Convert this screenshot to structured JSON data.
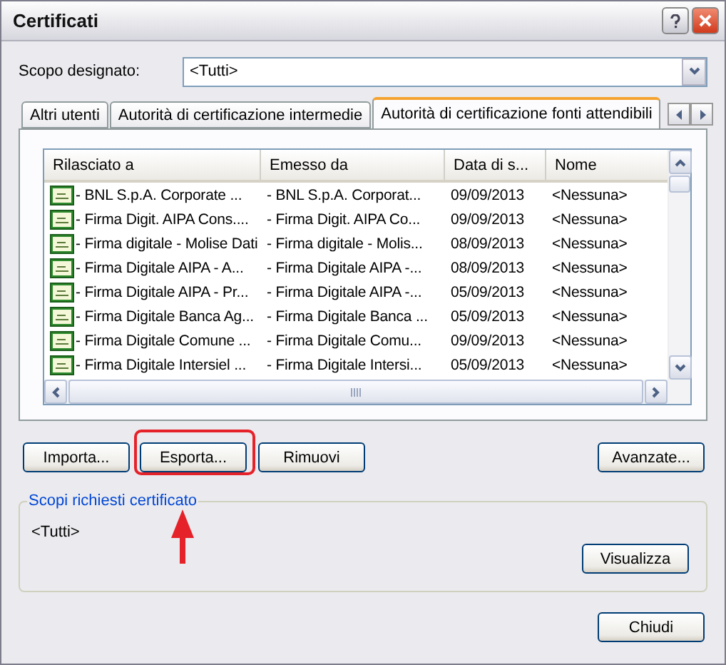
{
  "window": {
    "title": "Certificati"
  },
  "scope": {
    "label": "Scopo designato:",
    "value": "<Tutti>"
  },
  "tabs": [
    {
      "label": "Altri utenti",
      "selected": false
    },
    {
      "label": "Autorità di certificazione intermedie",
      "selected": false
    },
    {
      "label": "Autorità di certificazione fonti attendibili",
      "selected": true
    }
  ],
  "table": {
    "columns": [
      "Rilasciato a",
      "Emesso da",
      "Data di s...",
      "Nome"
    ],
    "rows": [
      [
        "- BNL S.p.A. Corporate ...",
        "- BNL S.p.A. Corporat...",
        "09/09/2013",
        "<Nessuna>"
      ],
      [
        "- Firma Digit. AIPA Cons....",
        "- Firma Digit. AIPA Co...",
        "09/09/2013",
        "<Nessuna>"
      ],
      [
        "- Firma digitale - Molise Dati",
        "- Firma digitale - Molis...",
        "08/09/2013",
        "<Nessuna>"
      ],
      [
        "- Firma Digitale AIPA - A...",
        "- Firma Digitale AIPA -...",
        "08/09/2013",
        "<Nessuna>"
      ],
      [
        "- Firma Digitale AIPA - Pr...",
        "- Firma Digitale AIPA -...",
        "05/09/2013",
        "<Nessuna>"
      ],
      [
        "- Firma Digitale Banca Ag...",
        "- Firma Digitale Banca ...",
        "05/09/2013",
        "<Nessuna>"
      ],
      [
        "- Firma Digitale Comune ...",
        "- Firma Digitale Comu...",
        "09/09/2013",
        "<Nessuna>"
      ],
      [
        "- Firma Digitale Intersiel ...",
        "- Firma Digitale Intersi...",
        "05/09/2013",
        "<Nessuna>"
      ]
    ]
  },
  "buttons": [
    {
      "label": "Importa...",
      "highlighted": false
    },
    {
      "label": "Esporta...",
      "highlighted": true
    },
    {
      "label": "Rimuovi",
      "highlighted": false
    }
  ],
  "advanced_button": "Avanzate...",
  "group": {
    "title": "Scopi richiesti certificato",
    "value": "<Tutti>",
    "button": "Visualizza"
  },
  "close_button": "Chiudi"
}
